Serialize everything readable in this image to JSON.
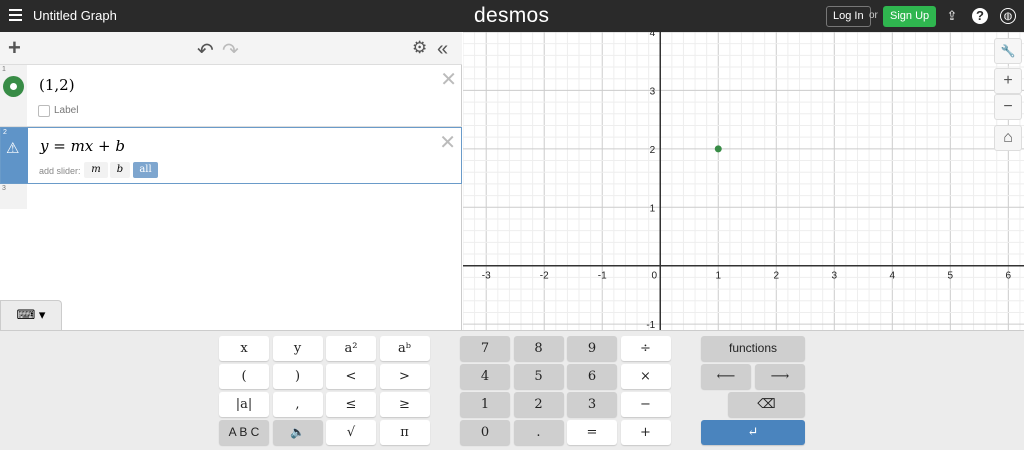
{
  "header": {
    "title": "Untitled Graph",
    "logo": "desmos",
    "login": "Log In",
    "or": "or",
    "signup": "Sign Up",
    "icons": [
      "share-icon",
      "help-icon",
      "globe-icon"
    ]
  },
  "toolbar": {
    "add": "+",
    "undo": "↶",
    "redo": "↷",
    "settings": "⚙",
    "collapse": "«"
  },
  "expressions": [
    {
      "num": "1",
      "latex": "(1,2)",
      "label_checkbox": "Label",
      "color": "#388c46"
    },
    {
      "num": "2",
      "latex": "y = mx + b",
      "slider_label": "add slider:",
      "sliders": [
        "m",
        "b",
        "all"
      ],
      "warning": "⚠"
    },
    {
      "num": "3"
    }
  ],
  "keyboard": {
    "toggle": "⌨ ▾",
    "left": [
      "x",
      "y",
      "a²",
      "aᵇ",
      "(",
      ")",
      "<",
      ">",
      "|a|",
      ",",
      "≤",
      "≥",
      "A B C",
      "🔈",
      "√",
      "π"
    ],
    "num": [
      "7",
      "8",
      "9",
      "÷",
      "4",
      "5",
      "6",
      "×",
      "1",
      "2",
      "3",
      "−",
      "0",
      ".",
      "=",
      "+"
    ],
    "functions": "functions",
    "left_arrow": "⟵",
    "right_arrow": "⟶",
    "backspace": "⌫",
    "enter": "↵"
  },
  "graph_controls": {
    "wrench": "🔧",
    "zoom_in": "+",
    "zoom_out": "−",
    "home": "⌂"
  },
  "chart_data": {
    "type": "scatter",
    "x_ticks": [
      "-3",
      "-2",
      "-1",
      "0",
      "1",
      "2",
      "3",
      "4",
      "5",
      "6"
    ],
    "y_ticks": [
      "-1",
      "1",
      "2",
      "3",
      "4"
    ],
    "xlim": [
      -3.4,
      6.27
    ],
    "ylim": [
      -1.1,
      4.0
    ],
    "points": [
      {
        "x": 1,
        "y": 2,
        "color": "#388c46"
      }
    ],
    "grid": true
  }
}
